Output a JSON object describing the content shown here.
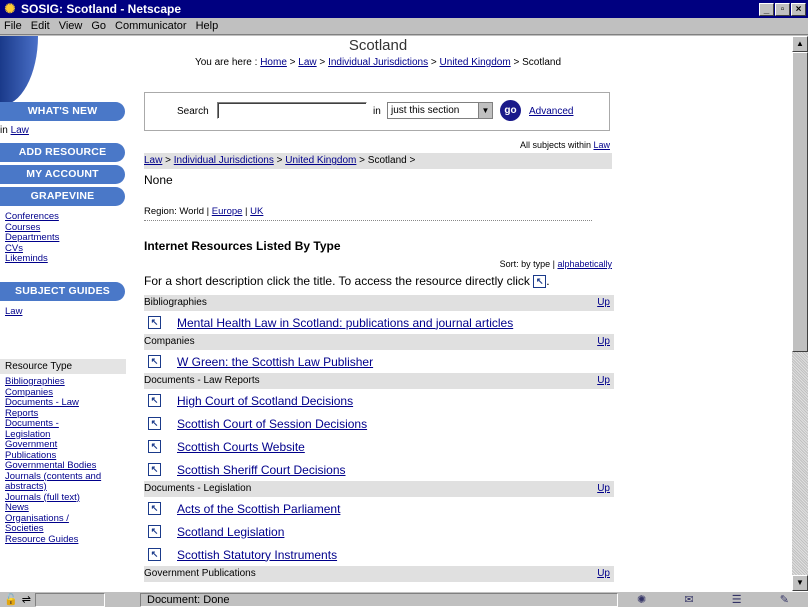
{
  "window": {
    "title": "SOSIG: Scotland - Netscape",
    "buttons": [
      "_",
      "▫",
      "×"
    ]
  },
  "menu": [
    "File",
    "Edit",
    "View",
    "Go",
    "Communicator",
    "Help"
  ],
  "page": {
    "heading": "Scotland",
    "you_are_here_label": "You are here : ",
    "crumbs": [
      "Home",
      "Law",
      "Individual Jurisdictions",
      "United Kingdom",
      "Scotland"
    ],
    "separator": " > "
  },
  "leftnav": {
    "whats_new": "WHAT'S NEW",
    "in_label": "in ",
    "in_link": "Law",
    "add_resource": "ADD RESOURCE",
    "my_account": "MY ACCOUNT",
    "grapevine": "GRAPEVINE",
    "grapevine_links": [
      "Conferences",
      "Courses",
      "Departments",
      "CVs",
      "Likeminds"
    ],
    "subject_guides": "SUBJECT GUIDES",
    "subject_link": "Law",
    "resource_type_label": "Resource Type",
    "resource_types": [
      "Bibliographies",
      "Companies",
      "Documents - Law",
      "Reports",
      "Documents -",
      "Legislation",
      "Government",
      "Publications",
      "Governmental Bodies",
      "Journals (contents and",
      "abstracts)",
      "Journals (full text)",
      "News",
      "Organisations /",
      "Societies",
      "Resource Guides"
    ]
  },
  "search": {
    "label": "Search",
    "value": "",
    "in_label": "in",
    "scope": "just this section",
    "go": "go",
    "advanced": "Advanced"
  },
  "all_subjects": {
    "label": "All subjects within ",
    "link": "Law"
  },
  "browse_crumbs": [
    "Law",
    "Individual Jurisdictions",
    "United Kingdom",
    "Scotland"
  ],
  "browse_trailing": " >",
  "none_text": "None",
  "region": {
    "label": "Region: World | ",
    "links": [
      "Europe",
      "UK"
    ]
  },
  "section_title": "Internet Resources Listed By Type",
  "sort": {
    "label": "Sort: by type | ",
    "link": "alphabetically"
  },
  "instruction": "For a short description click the title. To access the resource directly click",
  "instruction_end": ".",
  "up_label": "Up",
  "categories": [
    {
      "name": "Bibliographies",
      "items": [
        "Mental Health Law in Scotland: publications and journal articles"
      ]
    },
    {
      "name": "Companies",
      "items": [
        "W Green: the Scottish Law Publisher"
      ]
    },
    {
      "name": "Documents - Law Reports",
      "items": [
        "High Court of Scotland Decisions",
        "Scottish Court of Session Decisions",
        "Scottish Courts Website",
        "Scottish Sheriff Court Decisions"
      ]
    },
    {
      "name": "Documents - Legislation",
      "items": [
        "Acts of the Scottish Parliament",
        "Scotland Legislation",
        "Scottish Statutory Instruments"
      ]
    },
    {
      "name": "Government Publications",
      "items": []
    }
  ],
  "status": {
    "text": "Document: Done"
  },
  "colors": {
    "link": "#00008b",
    "nav_pill": "#4a78c8",
    "title_bar": "#000080"
  }
}
